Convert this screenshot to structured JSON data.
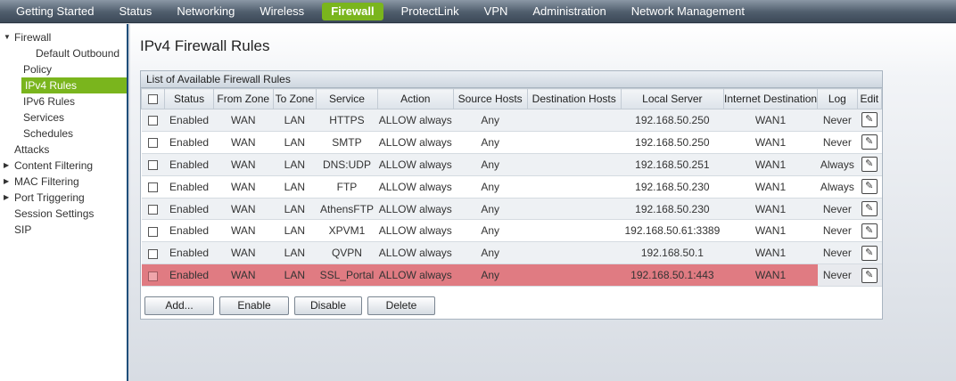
{
  "nav": {
    "items": [
      "Getting Started",
      "Status",
      "Networking",
      "Wireless",
      "Firewall",
      "ProtectLink",
      "VPN",
      "Administration",
      "Network Management"
    ],
    "active": "Firewall"
  },
  "sidebar": {
    "firewall": "Firewall",
    "default_outbound": "Default Outbound",
    "policy": "Policy",
    "ipv4_rules": "IPv4 Rules",
    "ipv6_rules": "IPv6 Rules",
    "services": "Services",
    "schedules": "Schedules",
    "attacks": "Attacks",
    "content_filtering": "Content Filtering",
    "mac_filtering": "MAC Filtering",
    "port_triggering": "Port Triggering",
    "session_settings": "Session Settings",
    "sip": "SIP"
  },
  "main": {
    "title": "IPv4 Firewall Rules",
    "panel_title": "List of Available Firewall Rules",
    "columns": [
      "Status",
      "From Zone",
      "To Zone",
      "Service",
      "Action",
      "Source Hosts",
      "Destination Hosts",
      "Local Server",
      "Internet Destination",
      "Log",
      "Edit"
    ],
    "rows": [
      {
        "status": "Enabled",
        "from": "WAN",
        "to": "LAN",
        "service": "HTTPS",
        "action": "ALLOW always",
        "src": "Any",
        "dst": "",
        "local": "192.168.50.250",
        "inet": "WAN1",
        "log": "Never"
      },
      {
        "status": "Enabled",
        "from": "WAN",
        "to": "LAN",
        "service": "SMTP",
        "action": "ALLOW always",
        "src": "Any",
        "dst": "",
        "local": "192.168.50.250",
        "inet": "WAN1",
        "log": "Never"
      },
      {
        "status": "Enabled",
        "from": "WAN",
        "to": "LAN",
        "service": "DNS:UDP",
        "action": "ALLOW always",
        "src": "Any",
        "dst": "",
        "local": "192.168.50.251",
        "inet": "WAN1",
        "log": "Always"
      },
      {
        "status": "Enabled",
        "from": "WAN",
        "to": "LAN",
        "service": "FTP",
        "action": "ALLOW always",
        "src": "Any",
        "dst": "",
        "local": "192.168.50.230",
        "inet": "WAN1",
        "log": "Always"
      },
      {
        "status": "Enabled",
        "from": "WAN",
        "to": "LAN",
        "service": "AthensFTP",
        "action": "ALLOW always",
        "src": "Any",
        "dst": "",
        "local": "192.168.50.230",
        "inet": "WAN1",
        "log": "Never"
      },
      {
        "status": "Enabled",
        "from": "WAN",
        "to": "LAN",
        "service": "XPVM1",
        "action": "ALLOW always",
        "src": "Any",
        "dst": "",
        "local": "192.168.50.61:3389",
        "inet": "WAN1",
        "log": "Never"
      },
      {
        "status": "Enabled",
        "from": "WAN",
        "to": "LAN",
        "service": "QVPN",
        "action": "ALLOW always",
        "src": "Any",
        "dst": "",
        "local": "192.168.50.1",
        "inet": "WAN1",
        "log": "Never"
      },
      {
        "status": "Enabled",
        "from": "WAN",
        "to": "LAN",
        "service": "SSL_Portal",
        "action": "ALLOW always",
        "src": "Any",
        "dst": "",
        "local": "192.168.50.1:443",
        "inet": "WAN1",
        "log": "Never"
      }
    ],
    "highlight_color": "#e07b82",
    "buttons": {
      "add": "Add...",
      "enable": "Enable",
      "disable": "Disable",
      "delete": "Delete"
    }
  },
  "icons": {
    "edit": "pencil-edit-icon",
    "expand": "triangle-expand-icon"
  },
  "colors": {
    "accent": "#7ab51d",
    "sidebar_border": "#1f4e7a"
  }
}
